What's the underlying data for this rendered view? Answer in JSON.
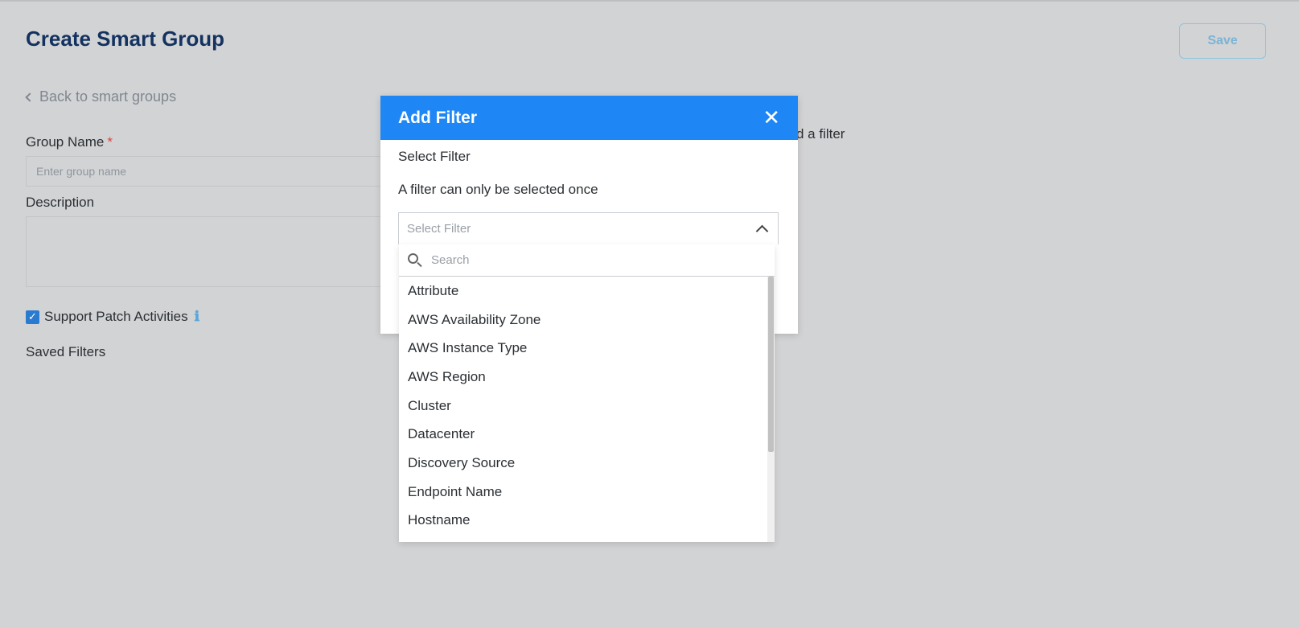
{
  "page": {
    "title": "Create Smart Group",
    "save_label": "Save",
    "back_label": "Back to smart groups",
    "group_name_label": "Group Name",
    "required_mark": "*",
    "group_name_placeholder": "Enter group name",
    "description_label": "Description",
    "support_patch_label": "Support Patch Activities",
    "support_patch_checked": true,
    "info_glyph": "ℹ",
    "saved_filters_label": "Saved Filters",
    "hint_text": "d a filter"
  },
  "modal": {
    "title": "Add Filter",
    "close_glyph": "✕",
    "select_filter_label": "Select Filter",
    "note": "A filter can only be selected once",
    "select_placeholder": "Select Filter",
    "header_color": "#1f87f5"
  },
  "dropdown": {
    "search_placeholder": "Search",
    "items": [
      "Attribute",
      "AWS Availability Zone",
      "AWS Instance Type",
      "AWS Region",
      "Cluster",
      "Datacenter",
      "Discovery Source",
      "Endpoint Name",
      "Hostname"
    ]
  },
  "icons": {
    "back": "chevron-left-icon",
    "close": "close-icon",
    "chevron_up": "chevron-up-icon",
    "search": "search-icon",
    "info": "info-icon",
    "checkbox": "checkmark-icon"
  }
}
